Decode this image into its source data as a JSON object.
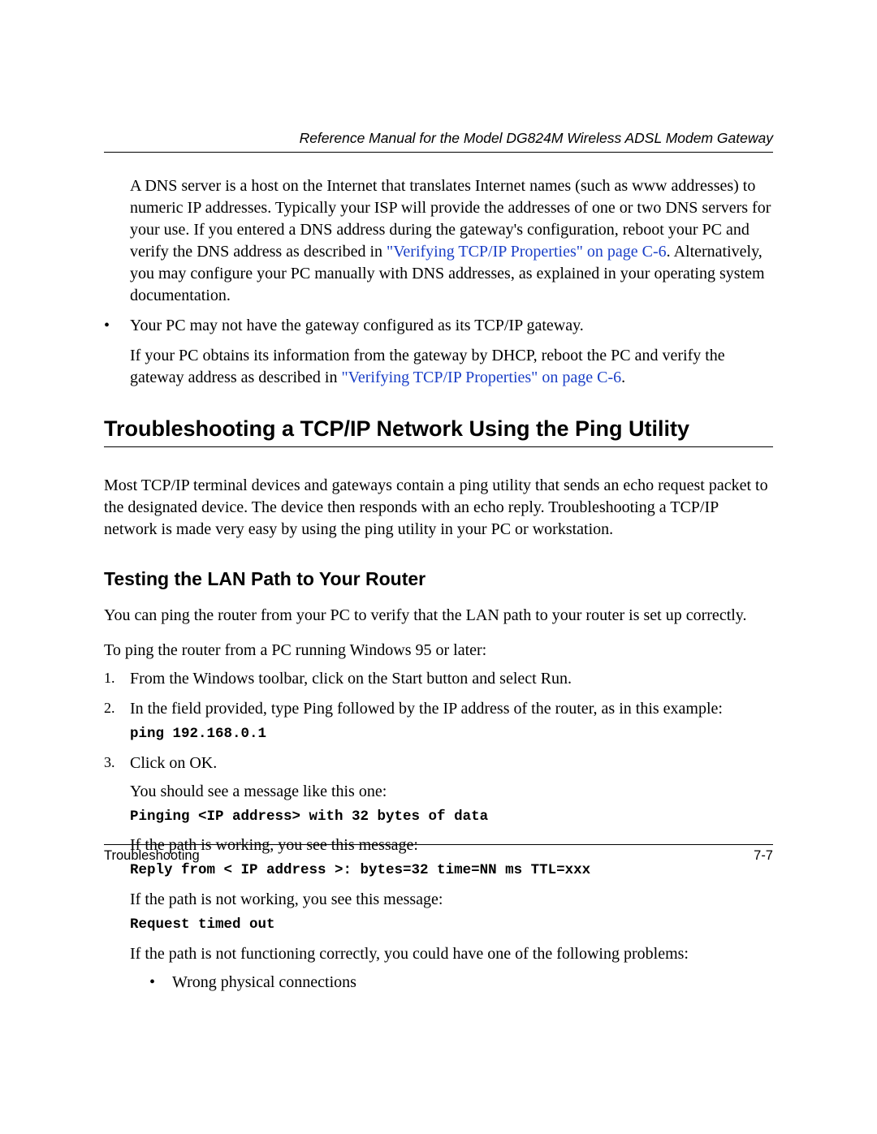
{
  "header": {
    "running_title": "Reference Manual for the Model DG824M Wireless ADSL Modem Gateway"
  },
  "para1": {
    "text_a": "A DNS server is a host on the Internet that translates Internet names (such as www addresses) to numeric IP addresses. Typically your ISP will provide the addresses of one or two DNS servers for your use. If you entered a DNS address during the gateway's configuration, reboot your PC and verify the DNS address as described in ",
    "link": "\"Verifying TCP/IP Properties\" on page C-6",
    "text_b": ". Alternatively, you may configure your PC manually with DNS addresses, as explained in your operating system documentation."
  },
  "bullet1": {
    "text": "Your PC may not have the gateway configured as its TCP/IP gateway."
  },
  "bullet1_follow": {
    "text_a": "If your PC obtains its information from the gateway by DHCP, reboot the PC and verify the gateway address as described in ",
    "link": "\"Verifying TCP/IP Properties\" on page C-6",
    "text_b": "."
  },
  "h1": "Troubleshooting a TCP/IP Network Using the Ping Utility",
  "intro": "Most TCP/IP terminal devices and gateways contain a ping utility that sends an echo request packet to the designated device. The device then responds with an echo reply. Troubleshooting a TCP/IP network is made very easy by using the ping utility in your PC or workstation.",
  "h2": "Testing the LAN Path to Your Router",
  "p2": "You can ping the router from your PC to verify that the LAN path to your router is set up correctly.",
  "p3": "To ping the router from a PC running Windows 95 or later:",
  "steps": {
    "s1": "From the Windows toolbar, click on the Start button and select Run.",
    "s2": "In the field provided, type Ping followed by the IP address of the router, as in this example:",
    "s2_code": "ping 192.168.0.1",
    "s3": "Click on OK.",
    "s3_a": "You should see a message like this one:",
    "s3_code1": "Pinging <IP address> with 32 bytes of data",
    "s3_b": "If the path is working, you see this message:",
    "s3_code2": "Reply from < IP address >: bytes=32 time=NN ms TTL=xxx",
    "s3_c": "If the path is not working, you see this message:",
    "s3_code3": "Request timed out",
    "s3_d": "If the path is not functioning correctly, you could have one of the following problems:",
    "s3_bullet": "Wrong physical connections"
  },
  "footer": {
    "left": "Troubleshooting",
    "right": "7-7"
  }
}
